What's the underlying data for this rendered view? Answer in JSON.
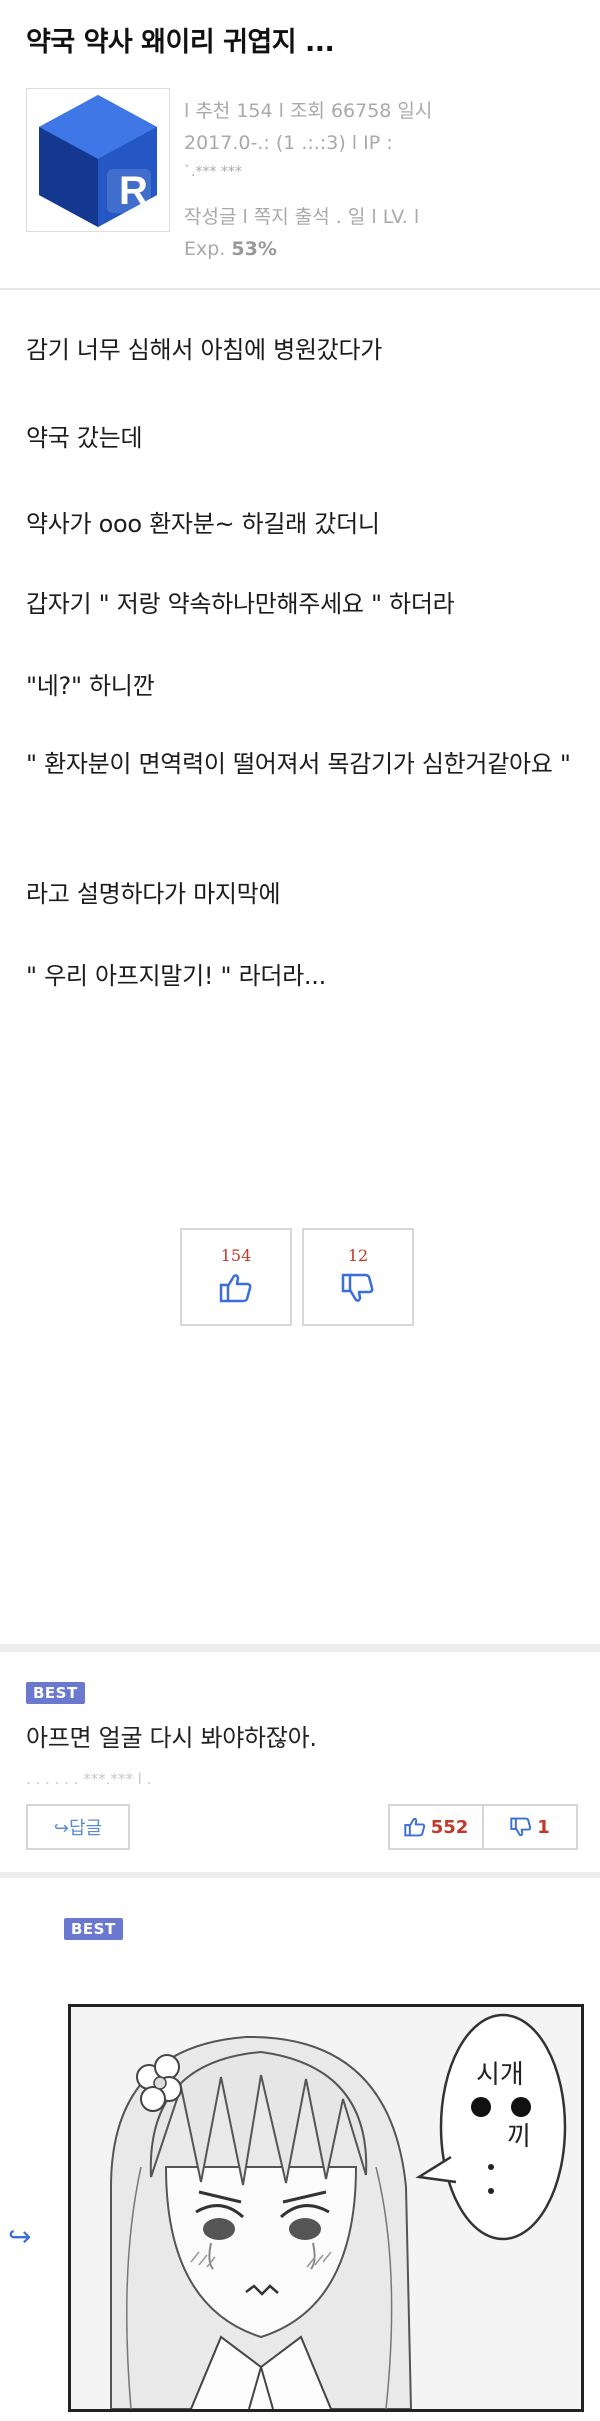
{
  "post": {
    "title": "약국 약사 왜이리 귀엽지 ...",
    "meta_line1": "l 추천 154 l 조회 66758 일시",
    "meta_line2": "2017.0-.:  (1 .:.:3) l IP :",
    "meta_line3": "`.*** ***",
    "meta_line4": "작성글 l 쪽지 출석 .     일 l  LV.    l",
    "exp_label": "Exp.",
    "exp_value": "53%",
    "avatar_letter": "R",
    "paragraphs": [
      "감기 너무 심해서 아침에 병원갔다가",
      "약국 갔는데",
      "약사가 ooo 환자분~ 하길래 갔더니",
      "갑자기 \" 저랑 약속하나만해주세요 \" 하더라",
      "\"네?\" 하니깐",
      "\" 환자분이 면역력이 떨어져서 목감기가 심한거같아요 \"",
      "라고 설명하다가 마지막에",
      "\" 우리 아프지말기! \" 라더라..."
    ],
    "upvotes": "154",
    "downvotes": "12"
  },
  "comments": [
    {
      "badge": "BEST",
      "text": "아프면 얼굴 다시 봐야하잖아.",
      "meta": ". .  .  .  .  . ***.***  l  .",
      "reply_label": "↪답글",
      "likes": "552",
      "dislikes": "1"
    },
    {
      "badge": "BEST",
      "speech_line1": "시개",
      "speech_line2": "끼",
      "speech_dots": "·\n·"
    }
  ],
  "colors": {
    "best_badge": "#6a79cf",
    "vote_count": "#c0392b",
    "thumb_icon": "#3a6fd8",
    "reply_text": "#5b8bd0"
  },
  "icons": [
    "thumbs-up-icon",
    "thumbs-down-icon",
    "reply-arrow-icon"
  ]
}
